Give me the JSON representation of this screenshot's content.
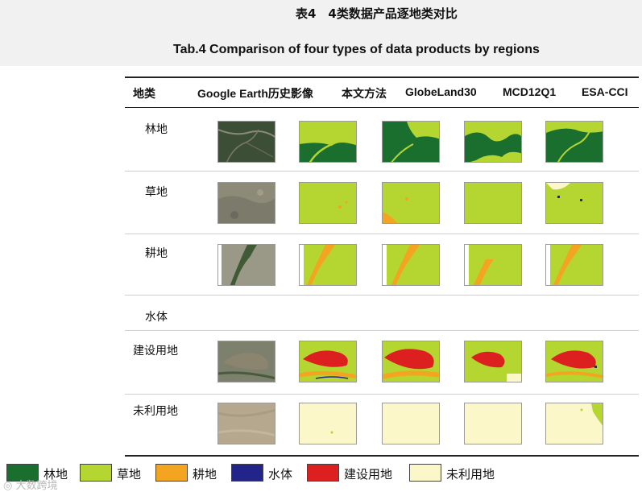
{
  "title_cn": "表4　4类数据产品逐地类对比",
  "title_en": "Tab.4  Comparison of four types of data products by regions",
  "columns": [
    "地类",
    "Google Earth历史影像",
    "本文方法",
    "GlobeLand30",
    "MCD12Q1",
    "ESA-CCI"
  ],
  "rows": [
    {
      "label": "林地",
      "has_images": true
    },
    {
      "label": "草地",
      "has_images": true
    },
    {
      "label": "耕地",
      "has_images": true
    },
    {
      "label": "水体",
      "has_images": false
    },
    {
      "label": "建设用地",
      "has_images": true
    },
    {
      "label": "未利用地",
      "has_images": true
    }
  ],
  "legend": [
    {
      "label": "林地",
      "color": "#1a6e2e"
    },
    {
      "label": "草地",
      "color": "#b5d630"
    },
    {
      "label": "耕地",
      "color": "#f3a522"
    },
    {
      "label": "水体",
      "color": "#23248a"
    },
    {
      "label": "建设用地",
      "color": "#dc2020"
    },
    {
      "label": "未利用地",
      "color": "#fbf7c8"
    }
  ],
  "watermark": "大数跨境"
}
